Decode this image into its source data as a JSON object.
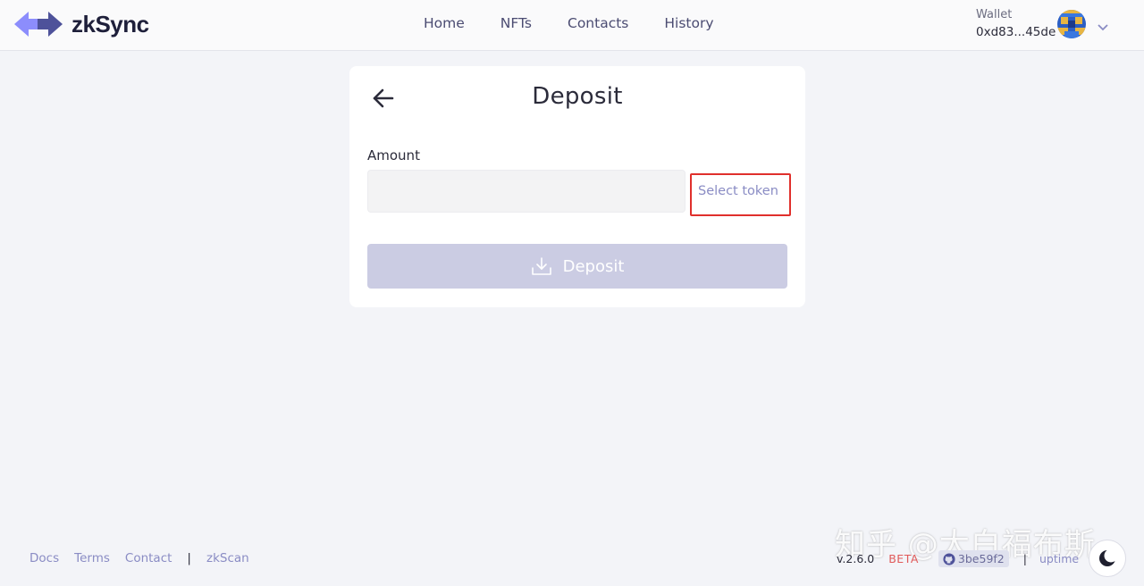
{
  "brand": {
    "name": "zkSync",
    "color": "#1e1f3a",
    "logo_colors": [
      "#8c8dfc",
      "#4e529a"
    ]
  },
  "nav": {
    "items": [
      {
        "label": "Home"
      },
      {
        "label": "NFTs"
      },
      {
        "label": "Contacts"
      },
      {
        "label": "History"
      }
    ]
  },
  "wallet": {
    "label": "Wallet",
    "address": "0xd83...45de",
    "avatar_icon": "pixel-avatar-icon"
  },
  "deposit": {
    "title": "Deposit",
    "amount_label": "Amount",
    "amount_value": "",
    "select_token_label": "Select token",
    "button_label": "Deposit",
    "button_color": "#cbcce3",
    "highlight_color": "#e0302c"
  },
  "footer": {
    "links": [
      {
        "label": "Docs"
      },
      {
        "label": "Terms"
      },
      {
        "label": "Contact"
      }
    ],
    "separator": "|",
    "explorer_label": "zkScan",
    "version": "v.2.6.0",
    "badge": "BETA",
    "commit": "3be59f2",
    "uptime_label": "uptime"
  },
  "watermark": "知乎 @大白福布斯"
}
